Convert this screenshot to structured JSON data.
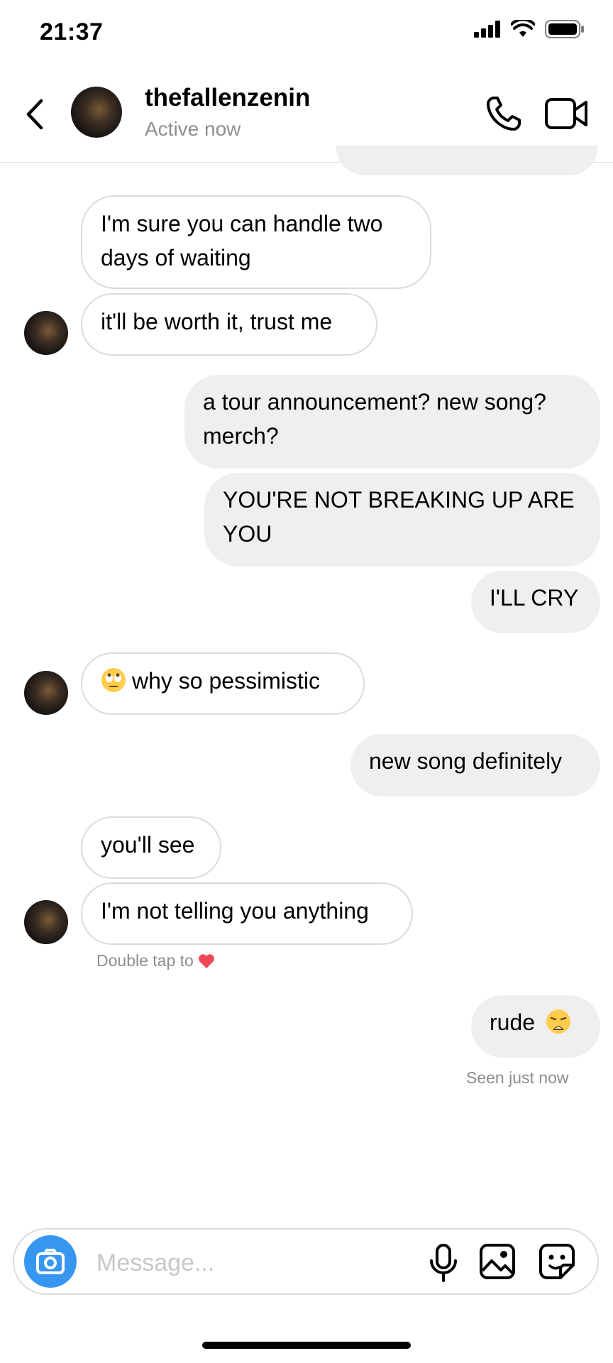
{
  "status_bar": {
    "time": "21:37"
  },
  "header": {
    "username": "thefallenzenin",
    "status": "Active now"
  },
  "messages": [
    {
      "dir": "in",
      "text": "I'm sure you can handle two days of waiting"
    },
    {
      "dir": "in",
      "text": "it'll be worth it, trust me"
    },
    {
      "dir": "out",
      "text": "a tour announcement? new song? merch?"
    },
    {
      "dir": "out",
      "text": "YOU'RE NOT BREAKING UP ARE YOU"
    },
    {
      "dir": "out",
      "text": "I'LL CRY"
    },
    {
      "dir": "in",
      "text": "why so pessimistic",
      "emoji": "eye-roll-emoji"
    },
    {
      "dir": "out",
      "text": "new song definitely"
    },
    {
      "dir": "in",
      "text": "you'll see"
    },
    {
      "dir": "in",
      "text": "I'm not telling you anything"
    },
    {
      "dir": "out",
      "text": "rude",
      "emoji": "weary-face-emoji"
    }
  ],
  "double_tap_hint": "Double tap to",
  "seen_text": "Seen just now",
  "composer": {
    "placeholder": "Message..."
  },
  "colors": {
    "accent": "#3797f0",
    "outgoing_bubble": "#efefef",
    "border": "#dbdbdb",
    "muted_text": "#8e8e8e",
    "heart": "#ed4956"
  }
}
